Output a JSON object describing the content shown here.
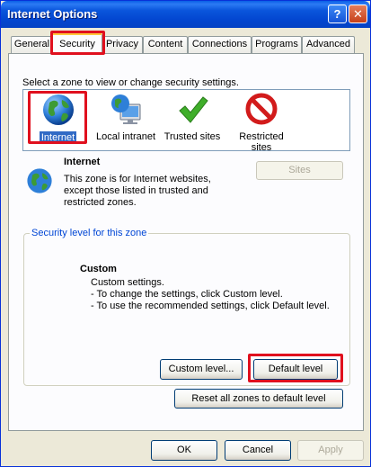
{
  "window": {
    "title": "Internet Options"
  },
  "titlebar_buttons": {
    "help": "?",
    "close": "✕"
  },
  "tabs": [
    {
      "label": "General"
    },
    {
      "label": "Security"
    },
    {
      "label": "Privacy"
    },
    {
      "label": "Content"
    },
    {
      "label": "Connections"
    },
    {
      "label": "Programs"
    },
    {
      "label": "Advanced"
    }
  ],
  "security": {
    "zone_prompt": "Select a zone to view or change security settings.",
    "zones": [
      {
        "label": "Internet",
        "icon": "globe-icon"
      },
      {
        "label": "Local intranet",
        "icon": "intranet-monitor-icon"
      },
      {
        "label": "Trusted sites",
        "icon": "green-checkmark-icon"
      },
      {
        "label": "Restricted sites",
        "icon": "restricted-red-circle-icon"
      }
    ],
    "selected_zone": {
      "title": "Internet",
      "desc": "This zone is for Internet websites, except those listed in trusted and restricted zones."
    },
    "sites_button": "Sites",
    "level_group_label": "Security level for this zone",
    "level": {
      "title": "Custom",
      "lines": [
        "Custom settings.",
        "- To change the settings, click Custom level.",
        "- To use the recommended settings, click Default level."
      ]
    },
    "custom_level_button": "Custom level...",
    "default_level_button": "Default level",
    "reset_all_button": "Reset all zones to default level"
  },
  "footer": {
    "ok": "OK",
    "cancel": "Cancel",
    "apply": "Apply"
  },
  "colors": {
    "highlight": "#e0101e",
    "selection": "#316ac5",
    "titlebar": "#0a56dc"
  }
}
